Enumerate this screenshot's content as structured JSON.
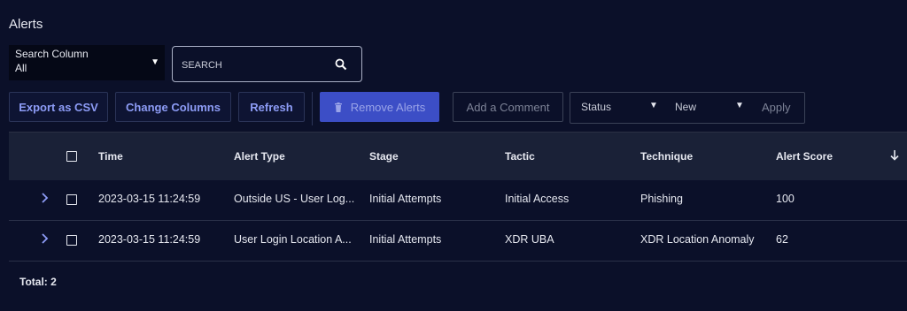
{
  "page": {
    "title": "Alerts"
  },
  "search": {
    "column_label": "Search Column",
    "column_value": "All",
    "placeholder": "SEARCH"
  },
  "toolbar": {
    "export_label": "Export as CSV",
    "change_columns_label": "Change Columns",
    "refresh_label": "Refresh",
    "remove_label": "Remove Alerts",
    "comment_label": "Add a Comment",
    "status_label": "Status",
    "status_value": "New",
    "apply_label": "Apply"
  },
  "table": {
    "columns": [
      "Time",
      "Alert Type",
      "Stage",
      "Tactic",
      "Technique",
      "Alert Score"
    ],
    "rows": [
      {
        "time": "2023-03-15 11:24:59",
        "alert_type": "Outside US - User Log...",
        "stage": "Initial Attempts",
        "tactic": "Initial Access",
        "technique": "Phishing",
        "score": "100"
      },
      {
        "time": "2023-03-15 11:24:59",
        "alert_type": "User Login Location A...",
        "stage": "Initial Attempts",
        "tactic": "XDR UBA",
        "technique": "XDR Location Anomaly",
        "score": "62"
      }
    ]
  },
  "footer": {
    "total": "Total: 2"
  },
  "colors": {
    "background": "#0b1029",
    "accent": "#8d9cf6",
    "primary": "#3c4ec6"
  }
}
